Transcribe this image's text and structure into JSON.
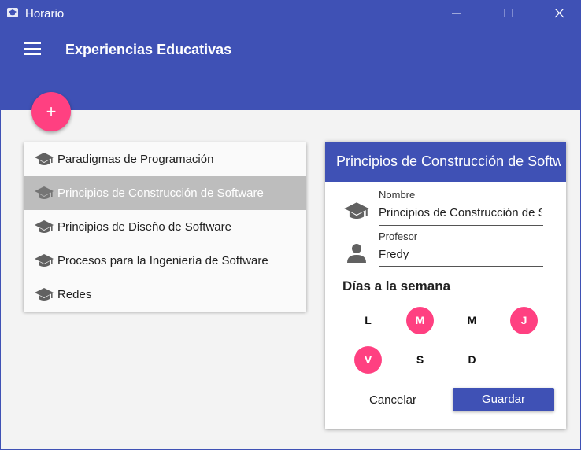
{
  "window": {
    "title": "Horario",
    "app_icon": "graduation-cap-icon",
    "controls": [
      "minimize-icon",
      "maximize-icon",
      "close-icon"
    ]
  },
  "appbar": {
    "menu_icon": "hamburger-menu-icon",
    "title": "Experiencias Educativas"
  },
  "fab": {
    "label": "+",
    "icon": "add-icon"
  },
  "courses": [
    {
      "name": "Paradigmas de Programación",
      "icon": "graduation-cap-icon",
      "selected": false
    },
    {
      "name": "Principios de Construcción de Software",
      "icon": "graduation-cap-icon",
      "selected": true
    },
    {
      "name": "Principios de Diseño de Software",
      "icon": "graduation-cap-icon",
      "selected": false
    },
    {
      "name": "Procesos para la Ingeniería de Software",
      "icon": "graduation-cap-icon",
      "selected": false
    },
    {
      "name": "Redes",
      "icon": "graduation-cap-icon",
      "selected": false
    }
  ],
  "detail": {
    "header": "Principios de Construcción de Software",
    "nombre_label": "Nombre",
    "nombre_value": "Principios de Construcción de Software",
    "profesor_label": "Profesor",
    "profesor_value": "Fredy",
    "days_title": "Días a la semana",
    "days": [
      {
        "label": "L",
        "active": false
      },
      {
        "label": "M",
        "active": true
      },
      {
        "label": "M",
        "active": false
      },
      {
        "label": "J",
        "active": true
      },
      {
        "label": "V",
        "active": true
      },
      {
        "label": "S",
        "active": false
      },
      {
        "label": "D",
        "active": false
      }
    ],
    "cancel_label": "Cancelar",
    "save_label": "Guardar"
  },
  "colors": {
    "primary": "#3f51b5",
    "accent": "#ff4081",
    "selected_row": "#bdbdbd",
    "background": "#f3f3f3"
  }
}
